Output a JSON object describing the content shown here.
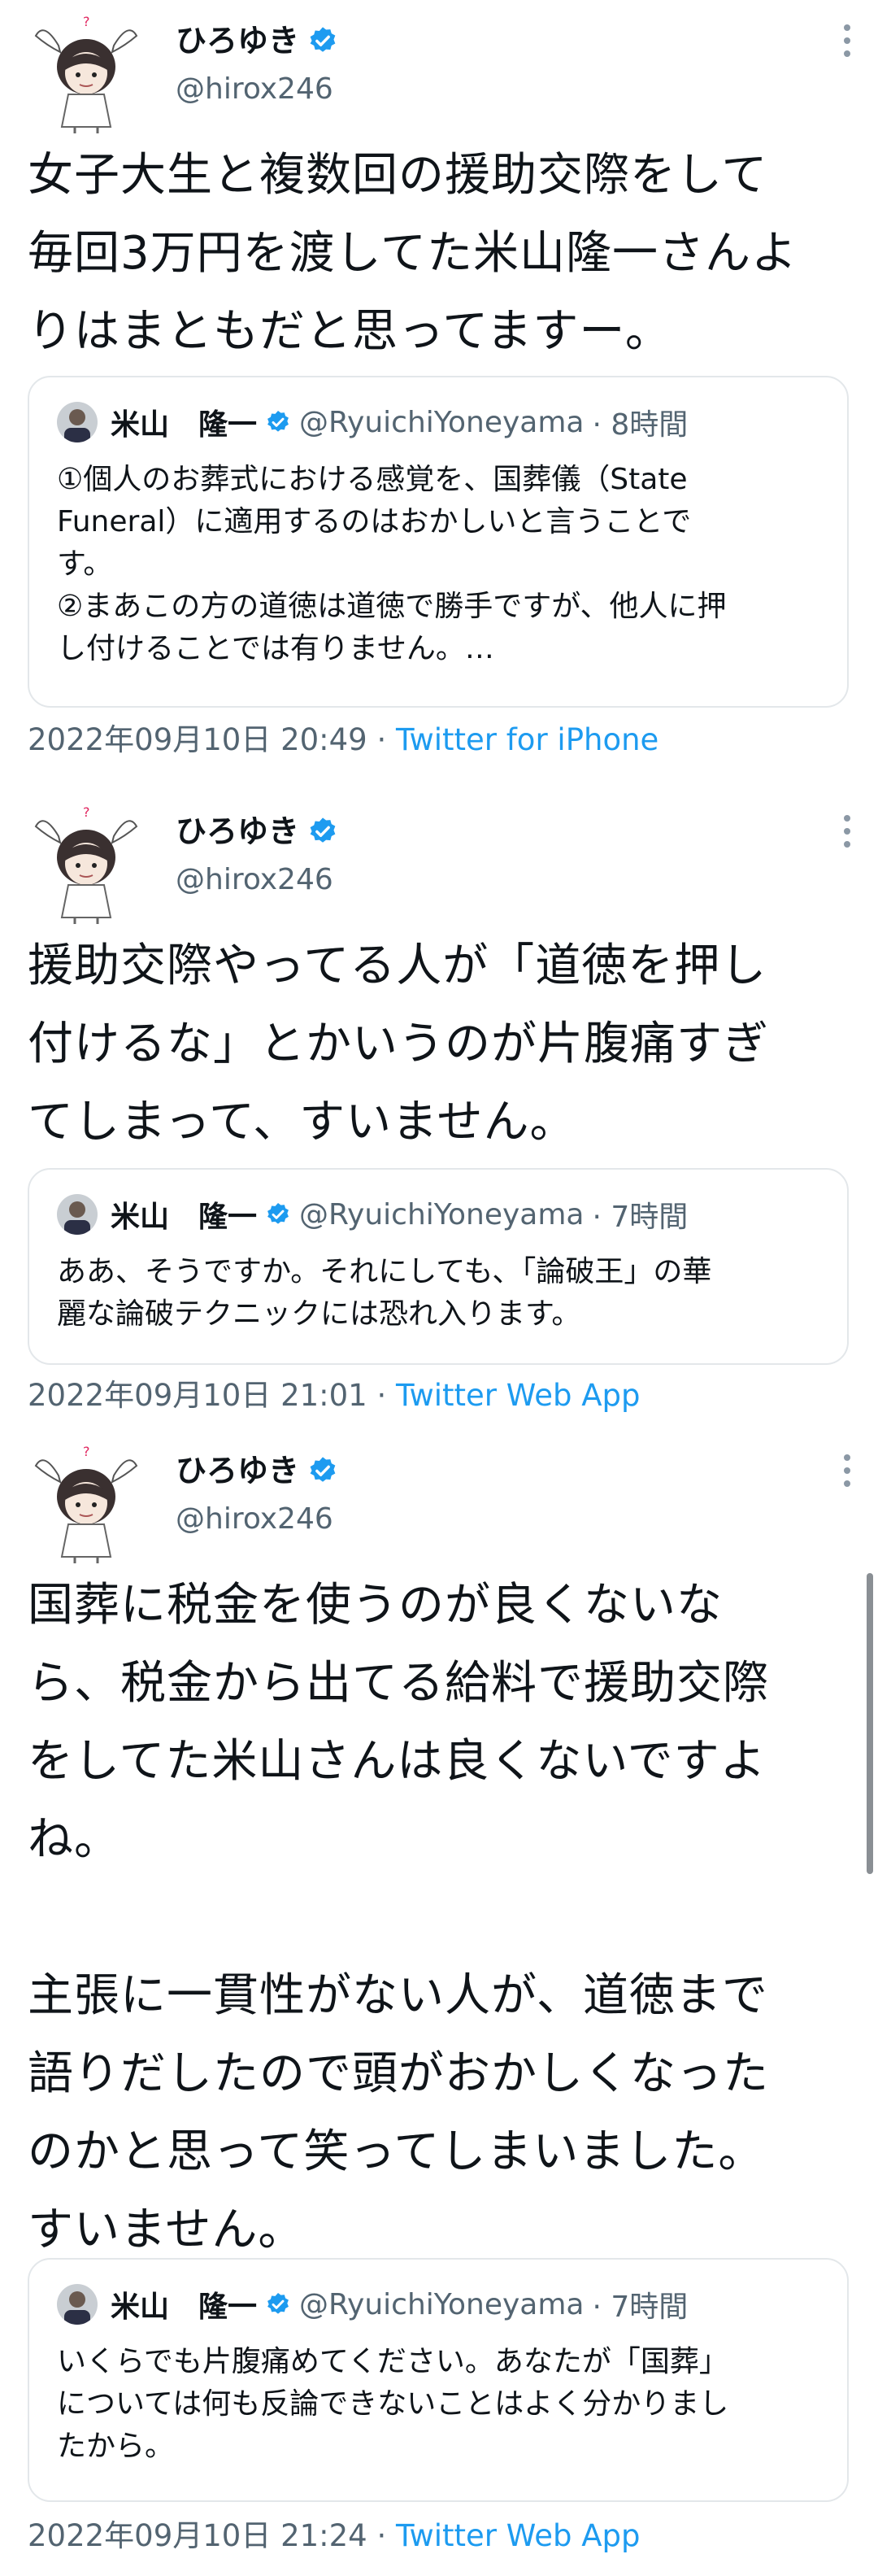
{
  "tweets": [
    {
      "author": {
        "name": "ひろゆき",
        "handle": "@hirox246"
      },
      "text": "女子大生と複数回の援助交際をして\n毎回3万円を渡してた米山隆一さんよ\nりはまともだと思ってますー。",
      "quote": {
        "name": "米山　隆一",
        "handle": "@RyuichiYoneyama",
        "time": "· 8時間",
        "text": "①個人のお葬式における感覚を、国葬儀（State\nFuneral）に適用するのはおかしいと言うことで\nす。\n②まあこの方の道徳は道徳で勝手ですが、他人に押\nし付けることでは有りません。…"
      },
      "timestamp": "2022年09月10日 20:49 ·",
      "app": "Twitter for iPhone"
    },
    {
      "author": {
        "name": "ひろゆき",
        "handle": "@hirox246"
      },
      "text": "援助交際やってる人が「道徳を押し\n付けるな」とかいうのが片腹痛すぎ\nてしまって、すいません。",
      "quote": {
        "name": "米山　隆一",
        "handle": "@RyuichiYoneyama",
        "time": "· 7時間",
        "text": "ああ、そうですか。それにしても、「論破王」の華\n麗な論破テクニックには恐れ入ります。"
      },
      "timestamp": "2022年09月10日 21:01 ·",
      "app": "Twitter Web App"
    },
    {
      "author": {
        "name": "ひろゆき",
        "handle": "@hirox246"
      },
      "text": "国葬に税金を使うのが良くないな\nら、税金から出てる給料で援助交際\nをしてた米山さんは良くないですよ\nね。\n\n主張に一貫性がない人が、道徳まで\n語りだしたので頭がおかしくなった\nのかと思って笑ってしまいました。\nすいません。",
      "quote": {
        "name": "米山　隆一",
        "handle": "@RyuichiYoneyama",
        "time": "· 7時間",
        "text": "いくらでも片腹痛めてください。あなたが「国葬」\nについては何も反論できないことはよく分かりまし\nたから。"
      },
      "timestamp": "2022年09月10日 21:24 ·",
      "app": "Twitter Web App"
    }
  ],
  "icons": {
    "verified": "verified-badge-icon",
    "more": "more-vertical-icon",
    "badge_color": "#1d9bf0"
  }
}
